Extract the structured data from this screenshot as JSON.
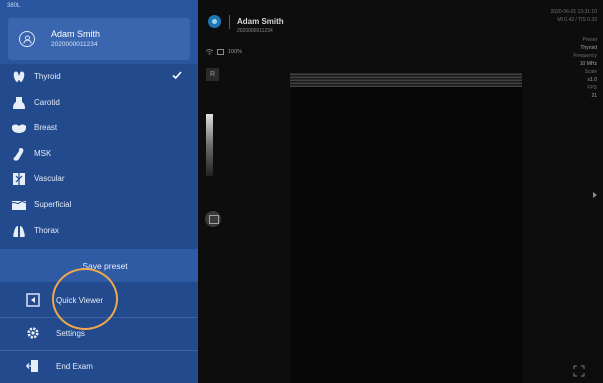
{
  "probe": {
    "name": "380L"
  },
  "user": {
    "name": "Adam Smith",
    "id": "2020000011234"
  },
  "menu": [
    {
      "label": "Thyroid",
      "icon": "thyroid-icon",
      "selected": true
    },
    {
      "label": "Carotid",
      "icon": "carotid-icon"
    },
    {
      "label": "Breast",
      "icon": "breast-icon"
    },
    {
      "label": "MSK",
      "icon": "msk-icon"
    },
    {
      "label": "Vascular",
      "icon": "vascular-icon"
    },
    {
      "label": "Superficial",
      "icon": "superficial-icon"
    },
    {
      "label": "Thorax",
      "icon": "thorax-icon"
    }
  ],
  "save_preset": "Save preset",
  "bottom_menu": [
    {
      "label": "Quick Viewer",
      "icon": "quick-viewer-icon"
    },
    {
      "label": "Settings",
      "icon": "gear-icon"
    },
    {
      "label": "End Exam",
      "icon": "exit-icon"
    }
  ],
  "viewer": {
    "patient_name": "Adam Smith",
    "patient_id": "2020000011234",
    "battery": "100%",
    "orientation_marker": "R",
    "datetime": "2020-06-01 13:31:10",
    "mi_ti": "MI 0.42 / TIS 0.33",
    "params": [
      {
        "label": "Preset",
        "value": "Thyroid"
      },
      {
        "label": "Frequency",
        "value": "10 MHz"
      },
      {
        "label": "Scale",
        "value": "x1.0"
      },
      {
        "label": "FPS",
        "value": "21"
      }
    ]
  },
  "colors": {
    "sidebar": "#234a8c",
    "accent_ring": "#f0a84c",
    "viewer_bg": "#0d0d0e"
  }
}
